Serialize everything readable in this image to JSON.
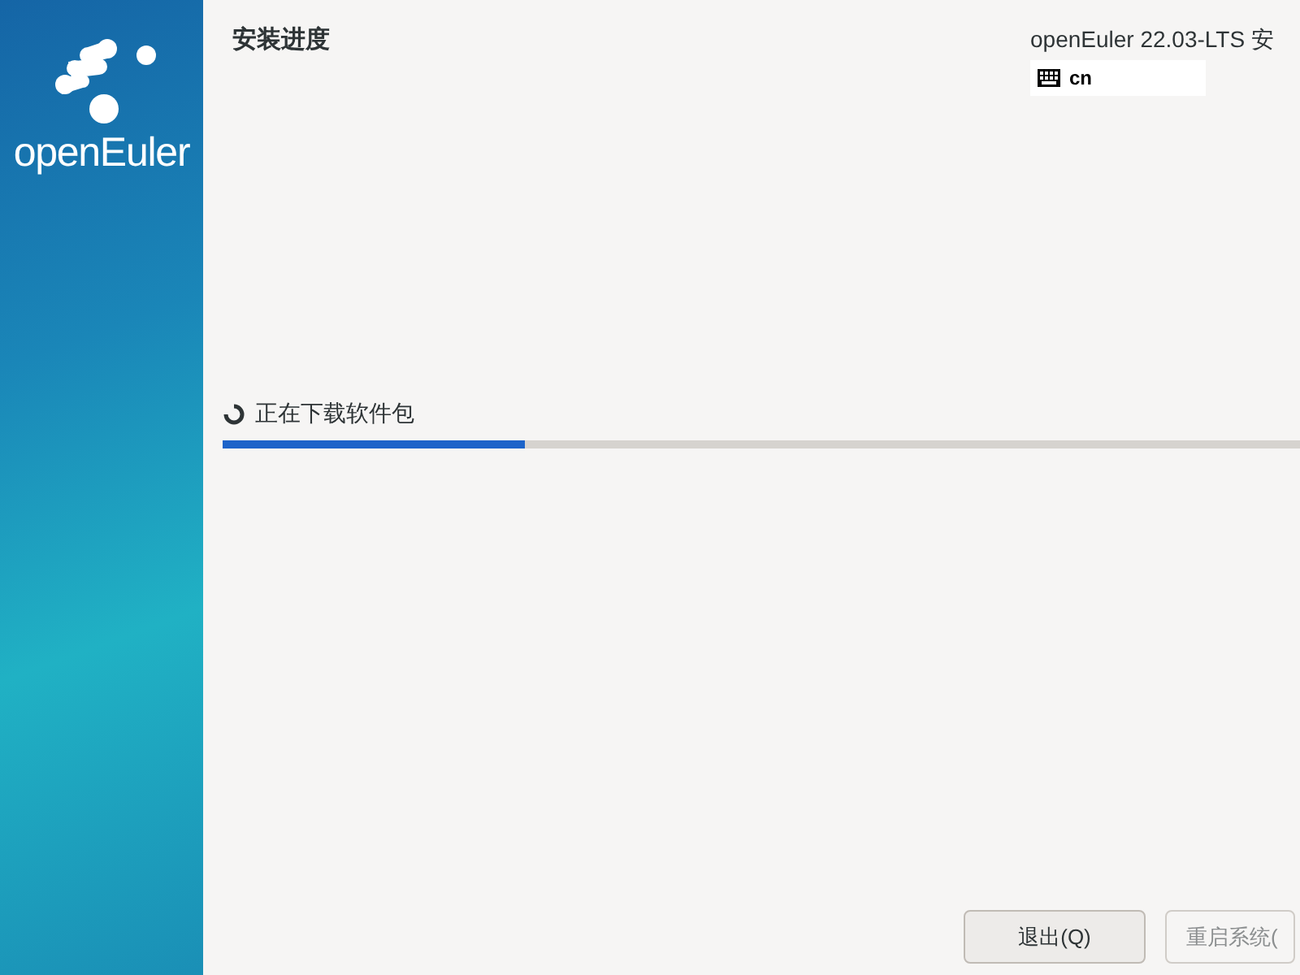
{
  "sidebar": {
    "logo_text": "openEuler"
  },
  "header": {
    "title": "安装进度",
    "product": "openEuler 22.03-LTS 安",
    "keyboard_layout": "cn"
  },
  "progress": {
    "status": "正在下载软件包",
    "level": 0.28
  },
  "buttons": [
    {
      "label": "退出(Q)",
      "disabled": false
    },
    {
      "label": "重启系统(",
      "disabled": true
    }
  ]
}
